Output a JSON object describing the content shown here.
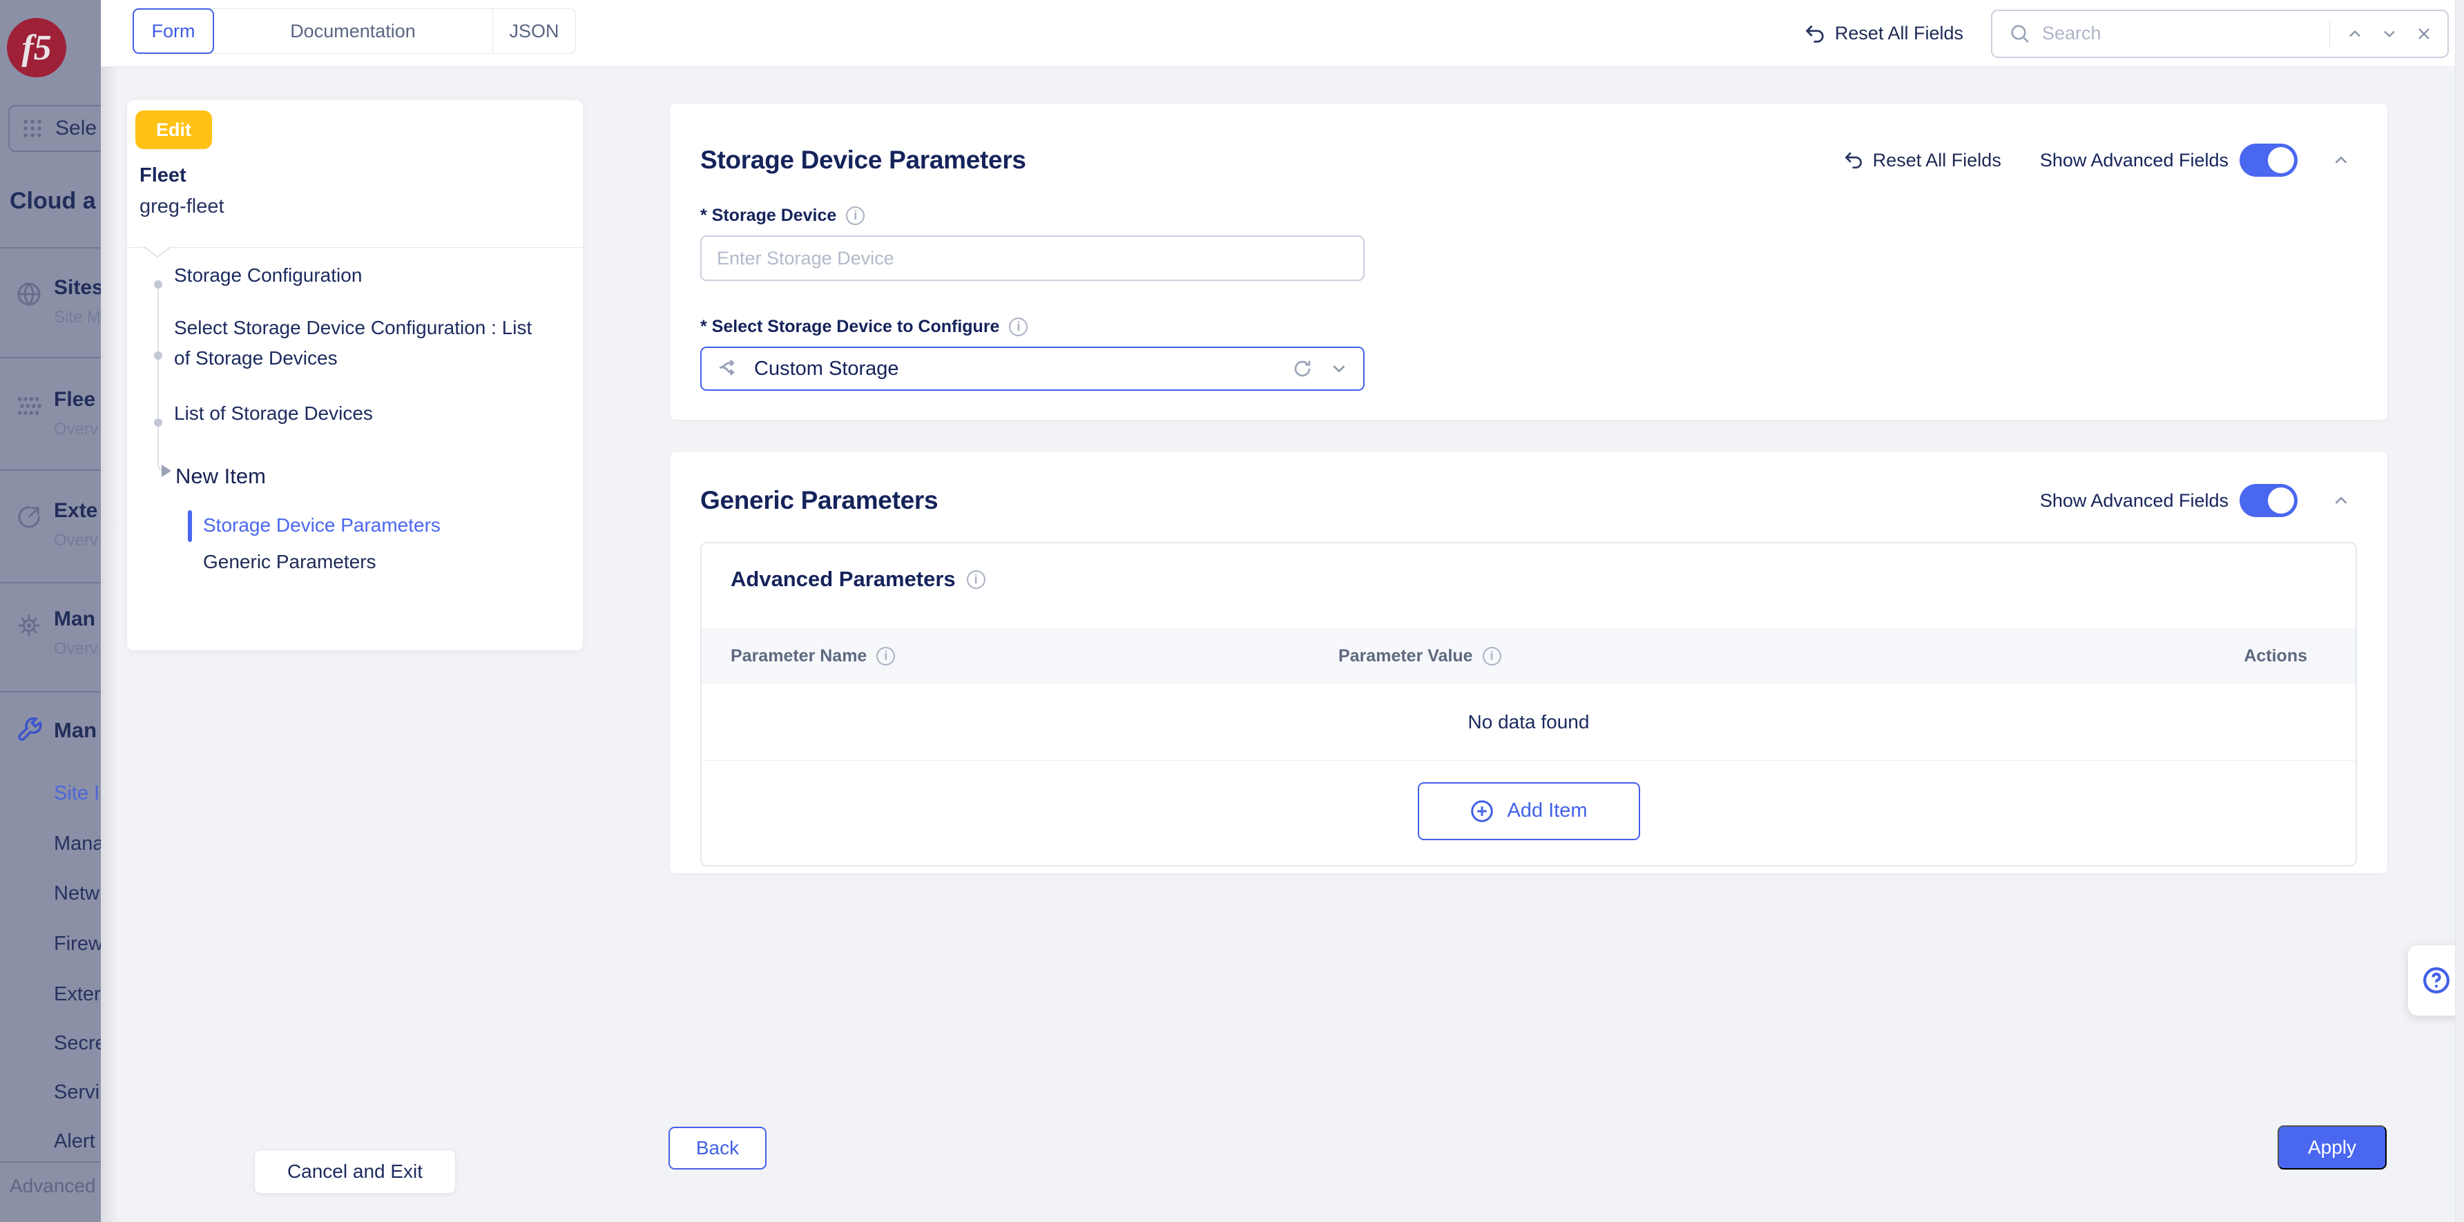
{
  "topbar": {
    "tabs": [
      {
        "label": "Form"
      },
      {
        "label": "Documentation"
      },
      {
        "label": "JSON"
      }
    ],
    "reset_label": "Reset All Fields",
    "search": {
      "placeholder": "Search"
    }
  },
  "sidebar": {
    "select_label": "Sele",
    "section_title": "Cloud a",
    "items": [
      {
        "title": "Sites",
        "subtitle": "Site M"
      },
      {
        "title": "Flee",
        "subtitle": "Overv"
      },
      {
        "title": "Exte",
        "subtitle": "Overv"
      },
      {
        "title": "Man",
        "subtitle": "Overv"
      }
    ],
    "manage": {
      "title": "Man",
      "links": [
        {
          "label": "Site I"
        },
        {
          "label": "Mana"
        },
        {
          "label": "Netw"
        },
        {
          "label": "Firew"
        },
        {
          "label": "Exter"
        },
        {
          "label": "Secre"
        },
        {
          "label": "Servi"
        },
        {
          "label": "Alert"
        }
      ]
    },
    "footer": "Advanced"
  },
  "wizard": {
    "badge": "Edit",
    "object_type": "Fleet",
    "object_name": "greg-fleet",
    "steps": [
      {
        "label": "Storage Configuration"
      },
      {
        "label": "Select Storage Device Configuration : List of Storage Devices"
      },
      {
        "label": "List of Storage Devices"
      }
    ],
    "current_step": "New Item",
    "substeps": [
      {
        "label": "Storage Device Parameters"
      },
      {
        "label": "Generic Parameters"
      }
    ],
    "cancel_label": "Cancel and Exit"
  },
  "form": {
    "storage_section": {
      "title": "Storage Device Parameters",
      "reset_label": "Reset All Fields",
      "advanced_label": "Show Advanced Fields",
      "fields": {
        "storage_device": {
          "label": "* Storage Device",
          "placeholder": "Enter Storage Device"
        },
        "select_storage": {
          "label": "* Select Storage Device to Configure",
          "value": "Custom Storage"
        }
      }
    },
    "generic_section": {
      "title": "Generic Parameters",
      "advanced_label": "Show Advanced Fields",
      "advanced_params": {
        "title": "Advanced Parameters",
        "columns": [
          {
            "label": "Parameter Name"
          },
          {
            "label": "Parameter Value"
          },
          {
            "label": "Actions"
          }
        ],
        "empty_text": "No data found",
        "add_label": "Add Item"
      }
    },
    "back_label": "Back",
    "apply_label": "Apply"
  },
  "colors": {
    "accent": "#4A67F0",
    "badge": "#FFC115",
    "navy": "#18265A",
    "sidebar_bg": "#8B90A7"
  }
}
